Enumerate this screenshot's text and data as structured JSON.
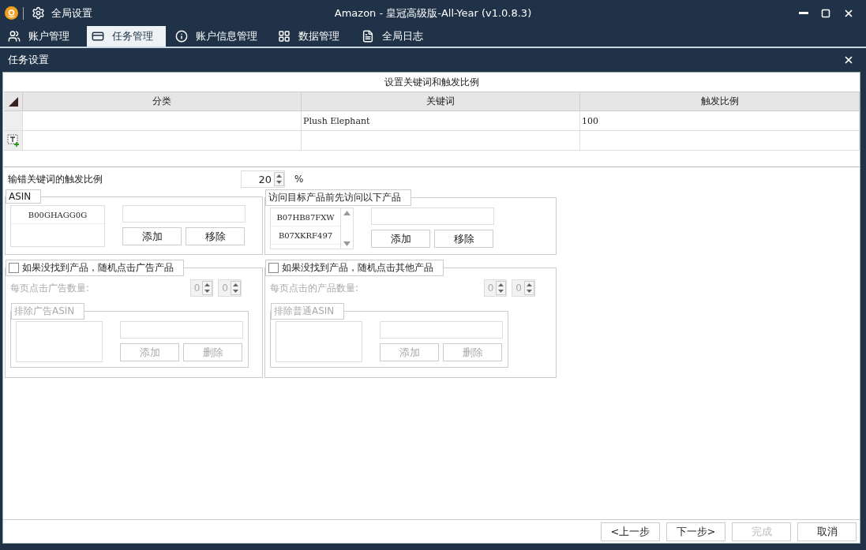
{
  "window": {
    "title": "Amazon - 皇冠高级版-All-Year  (v1.0.8.3)",
    "menu_label": "全局设置"
  },
  "tabs": [
    {
      "label": "账户管理",
      "kind": "users",
      "selected": false
    },
    {
      "label": "任务管理",
      "kind": "list",
      "selected": true
    },
    {
      "label": "账户信息管理",
      "kind": "info",
      "selected": false
    },
    {
      "label": "数据管理",
      "kind": "grid",
      "selected": false
    },
    {
      "label": "全局日志",
      "kind": "file",
      "selected": false
    }
  ],
  "panel": {
    "title": "任务设置"
  },
  "keyword_grid": {
    "caption": "设置关键词和触发比例",
    "columns": [
      "分类",
      "关键词",
      "触发比例"
    ],
    "rows": [
      {
        "cells": [
          "",
          "Plush Elephant",
          "100"
        ]
      }
    ]
  },
  "misspell": {
    "label": "输错关键词的触发比例",
    "value": "20",
    "unit": "%"
  },
  "asin_group": {
    "title": "ASIN",
    "items": [
      "B00GHAGG0G"
    ],
    "scrollbar": false,
    "buttons": [
      "添加",
      "移除"
    ]
  },
  "pre_visit_group": {
    "title": "访问目标产品前先访问以下产品",
    "items": [
      "B07HB87FXW",
      "B07XKRF497"
    ],
    "scrollbar": true,
    "buttons": [
      "添加",
      "移除"
    ]
  },
  "click_groups": [
    {
      "label": "如果没找到产品，随机点击广告产品",
      "checked": false,
      "count_label": "每页点击广告数量:",
      "counts": [
        "0",
        "0"
      ],
      "exclude_title": "排除广告ASIN",
      "buttons": [
        "添加",
        "删除"
      ]
    },
    {
      "label": "如果没找到产品，随机点击其他产品",
      "checked": false,
      "count_label": "每页点击的产品数量:",
      "counts": [
        "0",
        "0"
      ],
      "exclude_title": "排除普通ASIN",
      "buttons": [
        "添加",
        "删除"
      ]
    }
  ],
  "footer_buttons": [
    {
      "label": "<上一步",
      "disabled": false
    },
    {
      "label": "下一步>",
      "disabled": false
    },
    {
      "label": "完成",
      "disabled": true
    },
    {
      "label": "取消",
      "disabled": false
    }
  ]
}
